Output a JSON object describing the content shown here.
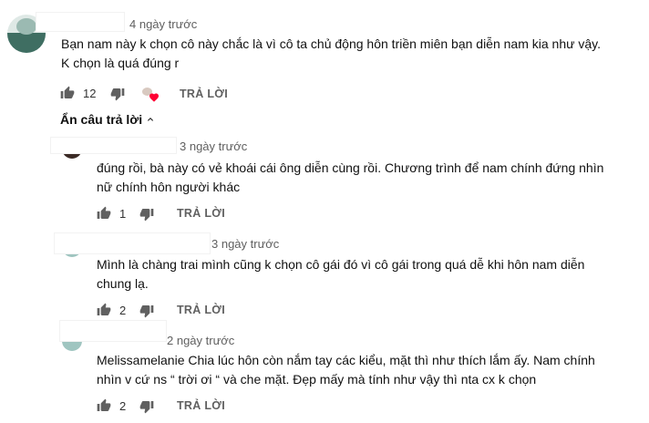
{
  "top_comment": {
    "timestamp": "4 ngày trước",
    "lines": [
      "Bạn nam này k chọn cô này chắc là vì cô ta chủ động hôn triền miên bạn diễn nam kia như vậy.",
      "K chọn là quá đúng r"
    ],
    "like_count": "12",
    "reply_label": "TRẢ LỜI",
    "heart_color": "#ff0033"
  },
  "hide_replies": {
    "label": "Ẩn câu trả lời"
  },
  "replies": [
    {
      "timestamp": "3 ngày trước",
      "lines": [
        "đúng rồi, bà này có vẻ khoái cái ông diễn cùng rồi. Chương trình để nam chính đứng nhìn",
        "nữ chính hôn người khác"
      ],
      "like_count": "1",
      "reply_label": "TRẢ LỜI"
    },
    {
      "timestamp": "3 ngày trước",
      "lines": [
        "Mình là chàng trai mình cũng k chọn cô gái đó vì cô gái trong quá dễ khi hôn nam diễn",
        "chung lạ."
      ],
      "like_count": "2",
      "reply_label": "TRẢ LỜI"
    },
    {
      "timestamp": "2 ngày trước",
      "lines": [
        "Melissamelanie Chia lúc hôn còn nắm tay các kiểu, mặt thì như thích lắm ấy. Nam chính",
        "nhìn v cứ ns “ trời ơi “ và che mặt. Đẹp mấy mà tính như vậy thì nta cx k chọn"
      ],
      "like_count": "2",
      "reply_label": "TRẢ LỜI"
    }
  ]
}
